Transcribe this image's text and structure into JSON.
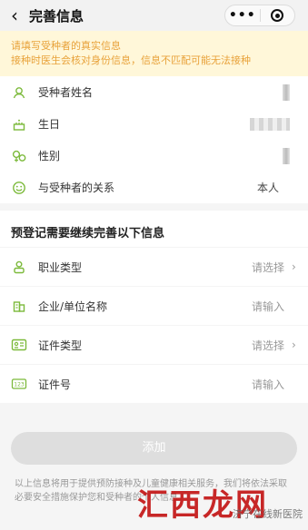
{
  "header": {
    "title": "完善信息",
    "more": "•••"
  },
  "notice": {
    "line1": "请填写受种者的真实信息",
    "line2": "接种时医生会核对身份信息，信息不匹配可能无法接种"
  },
  "basic": {
    "name_label": "受种者姓名",
    "birthday_label": "生日",
    "gender_label": "性别",
    "relation_label": "与受种者的关系",
    "relation_value": "本人"
  },
  "section": {
    "title": "预登记需要继续完善以下信息"
  },
  "fields": [
    {
      "label": "职业类型",
      "placeholder": "请选择"
    },
    {
      "label": "企业/单位名称",
      "placeholder": "请输入"
    },
    {
      "label": "证件类型",
      "placeholder": "请选择"
    },
    {
      "label": "证件号",
      "placeholder": "请输入"
    }
  ],
  "actions": {
    "add_label": "添加"
  },
  "footer": {
    "text": "以上信息将用于提供预防接种及儿童健康相关服务，我们将依法采取必要安全措施保护您和受种者的个人信息。"
  },
  "watermark": {
    "small": "济宁在线新医院",
    "big": "汇西龙网"
  },
  "colors": {
    "accent_green": "#7cba3b",
    "notice_bg": "#fff7d9",
    "notice_text": "#e8a23a"
  }
}
